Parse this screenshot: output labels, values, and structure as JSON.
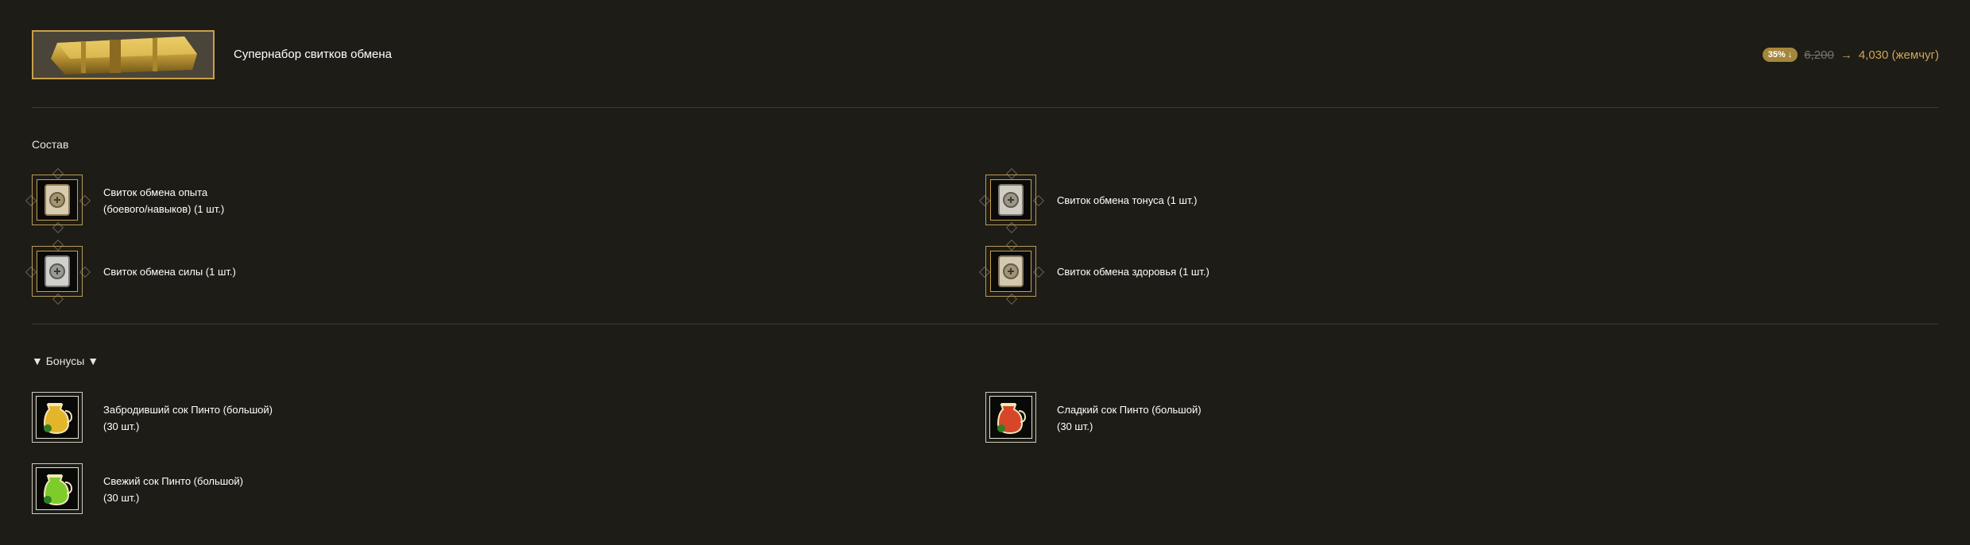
{
  "header": {
    "product_name": "Супернабор свитков обмена",
    "discount_badge": "35% ↓",
    "old_price": "6,200",
    "arrow": "→",
    "new_price": "4,030 (жемчуг)"
  },
  "composition": {
    "title": "Состав",
    "items": [
      {
        "line1": "Свиток обмена опыта",
        "line2": "(боевого/навыков) (1 шт.)",
        "icon": "scroll-exchange-icon"
      },
      {
        "line1": "Свиток обмена тонуса (1 шт.)",
        "line2": "",
        "icon": "scroll-exchange-icon"
      },
      {
        "line1": "Свиток обмена силы (1 шт.)",
        "line2": "",
        "icon": "scroll-exchange-icon"
      },
      {
        "line1": "Свиток обмена здоровья (1 шт.)",
        "line2": "",
        "icon": "scroll-exchange-icon"
      }
    ]
  },
  "bonuses": {
    "title": "▼ Бонусы ▼",
    "items": [
      {
        "line1": "Забродивший сок Пинто (большой)",
        "line2": "(30 шт.)",
        "icon": "juice-jug-icon",
        "color": "#e3b52a"
      },
      {
        "line1": "Сладкий сок Пинто (большой)",
        "line2": "(30 шт.)",
        "icon": "juice-jug-icon",
        "color": "#d8462a"
      },
      {
        "line1": "Свежий сок Пинто (большой)",
        "line2": "(30 шт.)",
        "icon": "juice-jug-icon",
        "color": "#7dcc2c"
      }
    ]
  }
}
